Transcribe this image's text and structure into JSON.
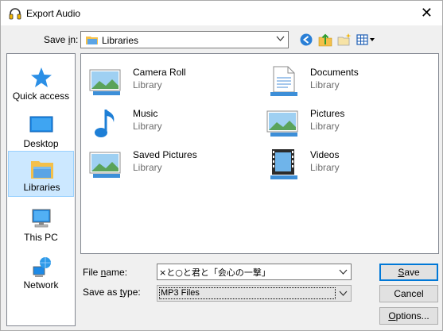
{
  "window": {
    "title": "Export Audio",
    "close_glyph": "✕"
  },
  "savein": {
    "label_pre": "Save ",
    "label_ul": "i",
    "label_post": "n:",
    "value": "Libraries"
  },
  "toolbar": {
    "back_icon": "back-icon",
    "up_icon": "up-folder-icon",
    "new_icon": "new-folder-icon",
    "views_icon": "view-menu-icon"
  },
  "places": [
    {
      "label": "Quick access",
      "icon": "star-icon"
    },
    {
      "label": "Desktop",
      "icon": "desktop-icon"
    },
    {
      "label": "Libraries",
      "icon": "libraries-icon",
      "selected": true
    },
    {
      "label": "This PC",
      "icon": "computer-icon"
    },
    {
      "label": "Network",
      "icon": "network-icon"
    }
  ],
  "items": [
    {
      "name": "Camera Roll",
      "sub": "Library",
      "icon": "picture-library-icon"
    },
    {
      "name": "Documents",
      "sub": "Library",
      "icon": "document-library-icon"
    },
    {
      "name": "Music",
      "sub": "Library",
      "icon": "music-library-icon"
    },
    {
      "name": "Pictures",
      "sub": "Library",
      "icon": "picture-library-icon"
    },
    {
      "name": "Saved Pictures",
      "sub": "Library",
      "icon": "picture-library-icon"
    },
    {
      "name": "Videos",
      "sub": "Library",
      "icon": "video-library-icon"
    }
  ],
  "form": {
    "filename_label_pre": "File ",
    "filename_label_ul": "n",
    "filename_label_post": "ame:",
    "filename_value": "×と○と君と「会心の一撃」",
    "savetype_label_pre": "Save as ",
    "savetype_label_ul": "t",
    "savetype_label_post": "ype:",
    "savetype_value": "MP3 Files"
  },
  "buttons": {
    "save_ul": "S",
    "save_rest": "ave",
    "cancel": "Cancel",
    "options_ul": "O",
    "options_rest": "ptions..."
  },
  "colors": {
    "selection": "#cce8ff",
    "accent": "#0078d7"
  }
}
